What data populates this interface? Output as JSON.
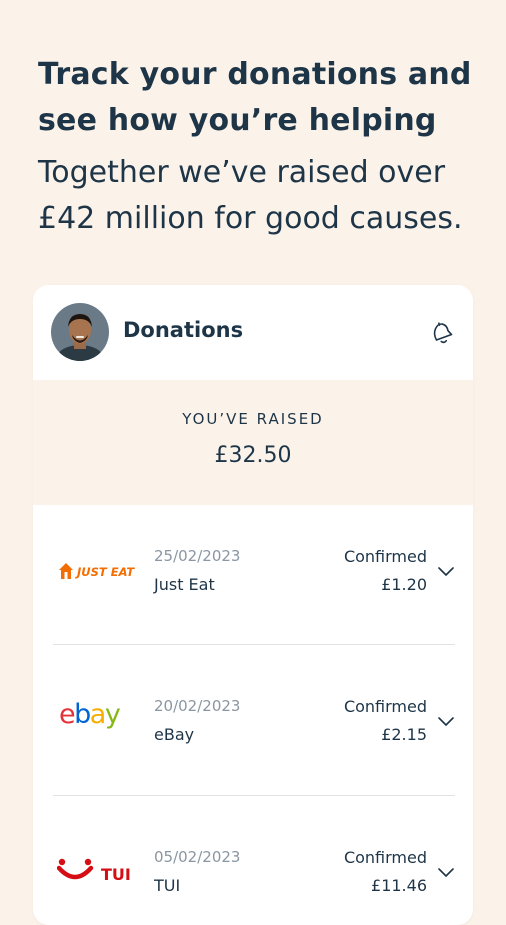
{
  "headline": "Track your donations and see how you’re helping",
  "subline": "Together we’ve raised over £42 million for good causes.",
  "card": {
    "title": "Donations",
    "raised_label": "YOU’VE RAISED",
    "raised_amount": "£32.50"
  },
  "donations": [
    {
      "logo": "just-eat-logo",
      "logo_text": "JUST EAT",
      "date": "25/02/2023",
      "merchant": "Just Eat",
      "status": "Confirmed",
      "amount": "£1.20"
    },
    {
      "logo": "ebay-logo",
      "logo_text": "ebay",
      "date": "20/02/2023",
      "merchant": "eBay",
      "status": "Confirmed",
      "amount": "£2.15"
    },
    {
      "logo": "tui-logo",
      "logo_text": "TUI",
      "date": "05/02/2023",
      "merchant": "TUI",
      "status": "Confirmed",
      "amount": "£11.46"
    }
  ],
  "icons": {
    "bell": "bell-icon",
    "chevron": "chevron-down-icon",
    "avatar": "avatar"
  },
  "colors": {
    "background": "#fbf3ea",
    "text": "#1e3548",
    "just_eat_orange": "#f36d00",
    "ebay_red": "#e53238",
    "ebay_blue": "#0064d2",
    "ebay_yellow": "#f5af02",
    "ebay_green": "#86b817",
    "tui_red": "#d40e14"
  }
}
